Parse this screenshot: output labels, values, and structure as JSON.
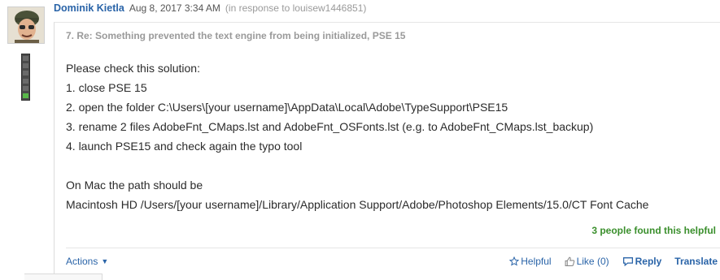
{
  "header": {
    "author": "Dominik Kietla",
    "date": "Aug 8, 2017 3:34 AM",
    "in_response": "(in response to louisew1446851)"
  },
  "post": {
    "title": "7. Re: Something prevented the text engine from being initialized, PSE 15",
    "lines": [
      "Please check this solution:",
      "1. close PSE 15",
      "2. open the folder C:\\Users\\[your username]\\AppData\\Local\\Adobe\\TypeSupport\\PSE15",
      "3. rename 2 files  AdobeFnt_CMaps.lst and AdobeFnt_OSFonts.lst (e.g. to AdobeFnt_CMaps.lst_backup)",
      "4. launch PSE15 and check again the typo tool",
      "",
      "On Mac the path should be",
      "Macintosh HD /Users/[your username]/Library/Application Support/Adobe/Photoshop Elements/15.0/CT Font Cache"
    ],
    "helpful_count": "3 people found this helpful"
  },
  "actions": {
    "menu_label": "Actions",
    "helpful_label": "Helpful",
    "like_label": "Like (0)",
    "reply_label": "Reply",
    "translate_label": "Translate"
  },
  "colors": {
    "link": "#2a64a8",
    "helpful_green": "#3a8f2c",
    "meter_on": "#59b84a"
  },
  "icons": {
    "star": "star-icon",
    "thumb": "thumbs-up-icon",
    "reply": "speech-bubble-icon",
    "caret": "chevron-down-icon"
  }
}
